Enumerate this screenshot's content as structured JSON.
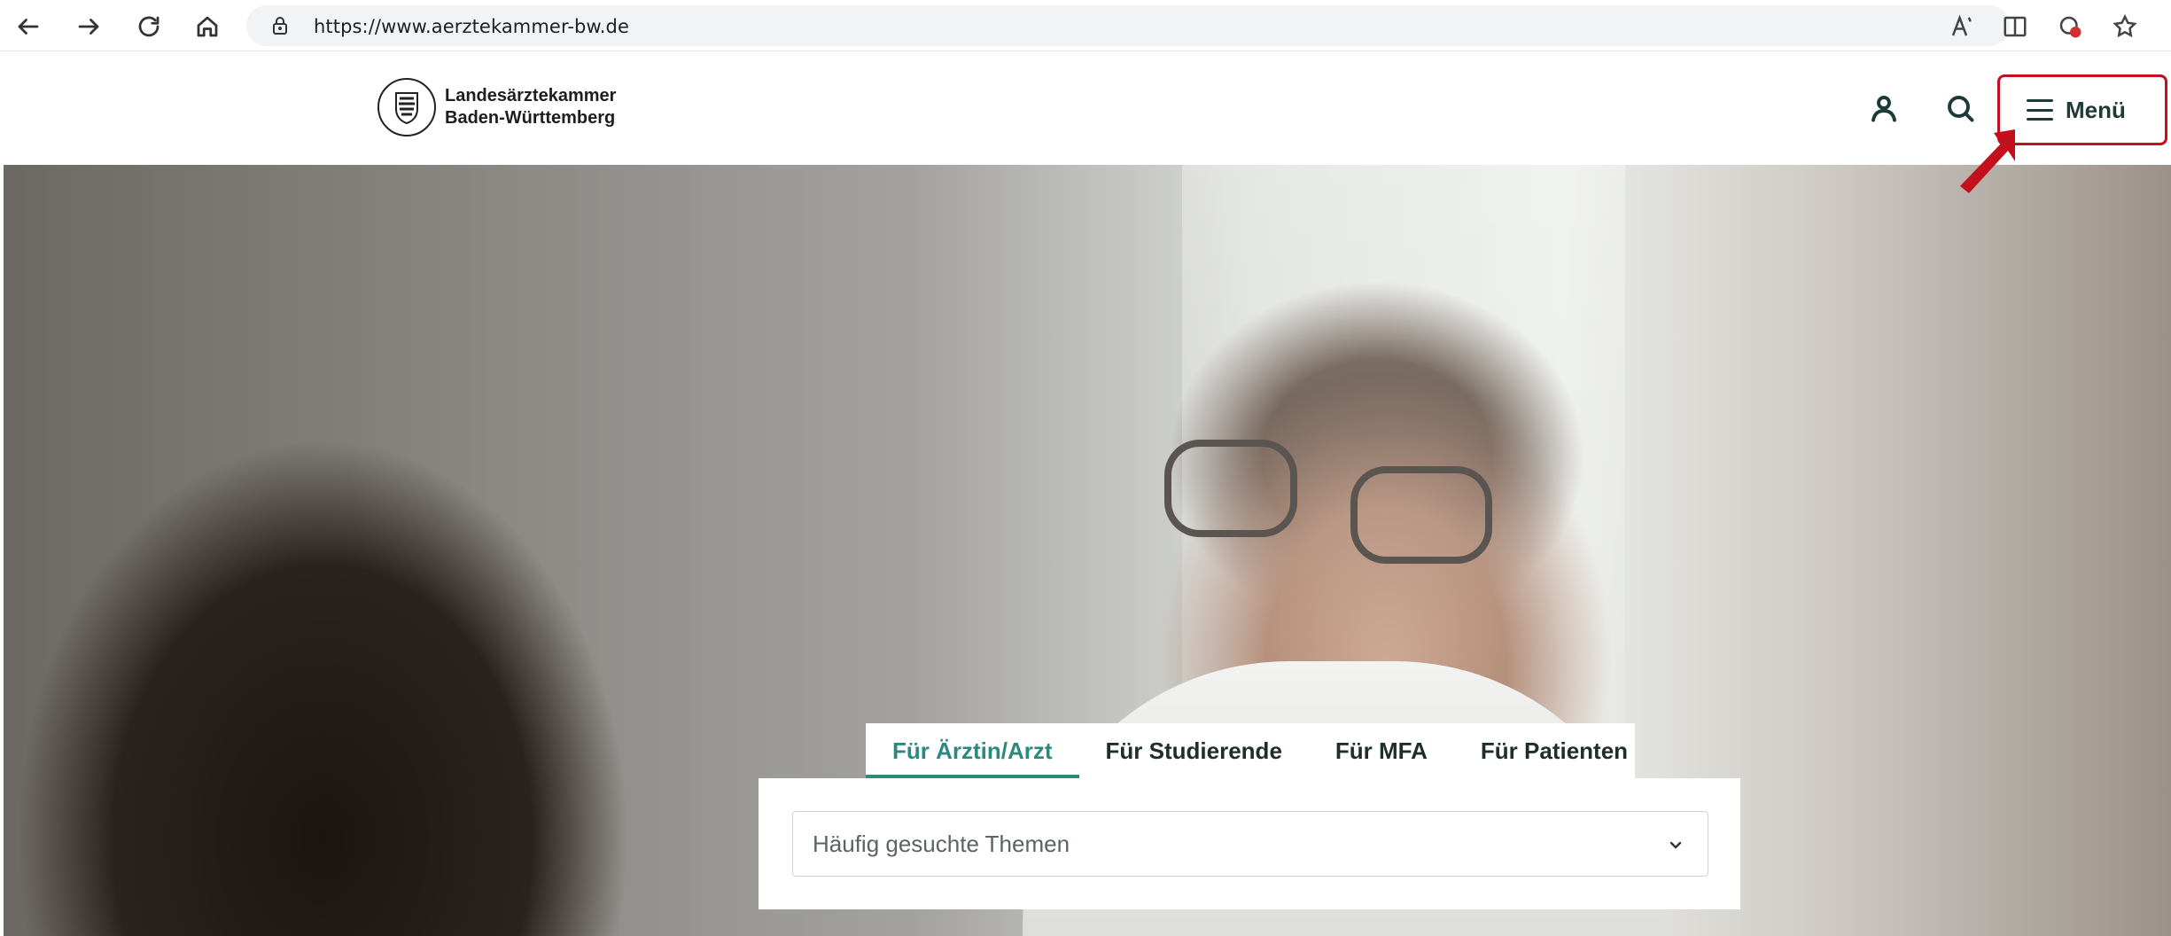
{
  "browser": {
    "url": "https://www.aerztekammer-bw.de",
    "icons": [
      "back-arrow-icon",
      "forward-arrow-icon",
      "reload-icon",
      "home-icon",
      "lock-icon",
      "read-aloud-icon",
      "immersive-reader-icon",
      "extension-icon",
      "favorite-star-icon"
    ]
  },
  "header": {
    "logo_line1": "Landesärztekammer",
    "logo_line2": "Baden-Württemberg",
    "account_icon": "user-icon",
    "search_icon": "search-icon",
    "menu_label": "Menü"
  },
  "hero": {
    "tabs": [
      {
        "label": "Für Ärztin/Arzt",
        "active": true
      },
      {
        "label": "Für Studierende",
        "active": false
      },
      {
        "label": "Für MFA",
        "active": false
      },
      {
        "label": "Für Patienten",
        "active": false
      }
    ],
    "select": {
      "placeholder": "Häufig gesuchte Themen"
    }
  },
  "colors": {
    "accent": "#2a8a7f",
    "highlight_border": "#c2111c",
    "text_dark": "#1e3a37"
  }
}
